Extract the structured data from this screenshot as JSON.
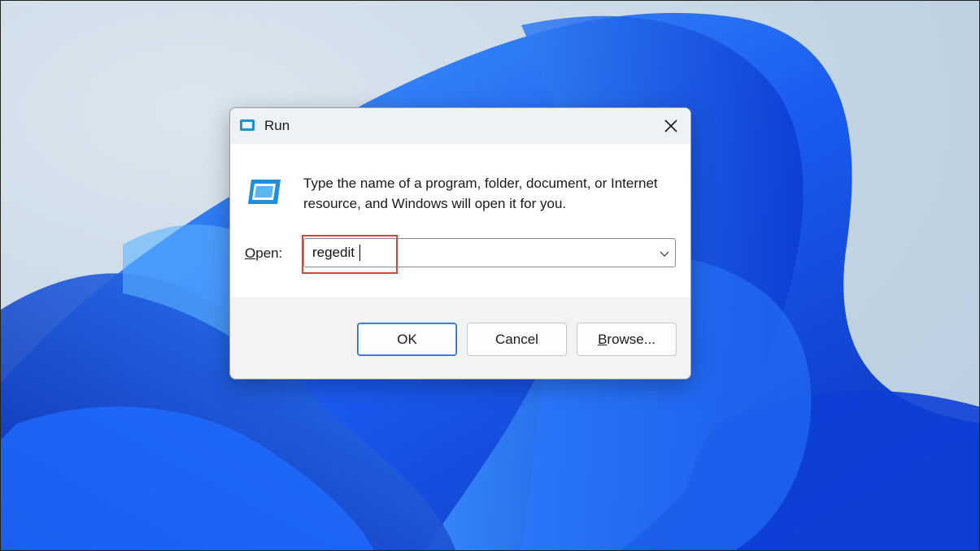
{
  "dialog": {
    "title": "Run",
    "description": "Type the name of a program, folder, document, or Internet resource, and Windows will open it for you.",
    "open_label_access_key": "O",
    "open_label_rest": "pen:",
    "input_value": "regedit",
    "buttons": {
      "ok": "OK",
      "cancel": "Cancel",
      "browse_access_key": "B",
      "browse_rest": "rowse..."
    }
  },
  "icons": {
    "title": "run-app-icon",
    "close": "close-icon",
    "large": "run-app-icon",
    "dropdown": "chevron-down-icon"
  },
  "colors": {
    "accent": "#2a6ad1",
    "highlight": "#e0413f",
    "wallpaper_blue": "#1a5cf0"
  }
}
